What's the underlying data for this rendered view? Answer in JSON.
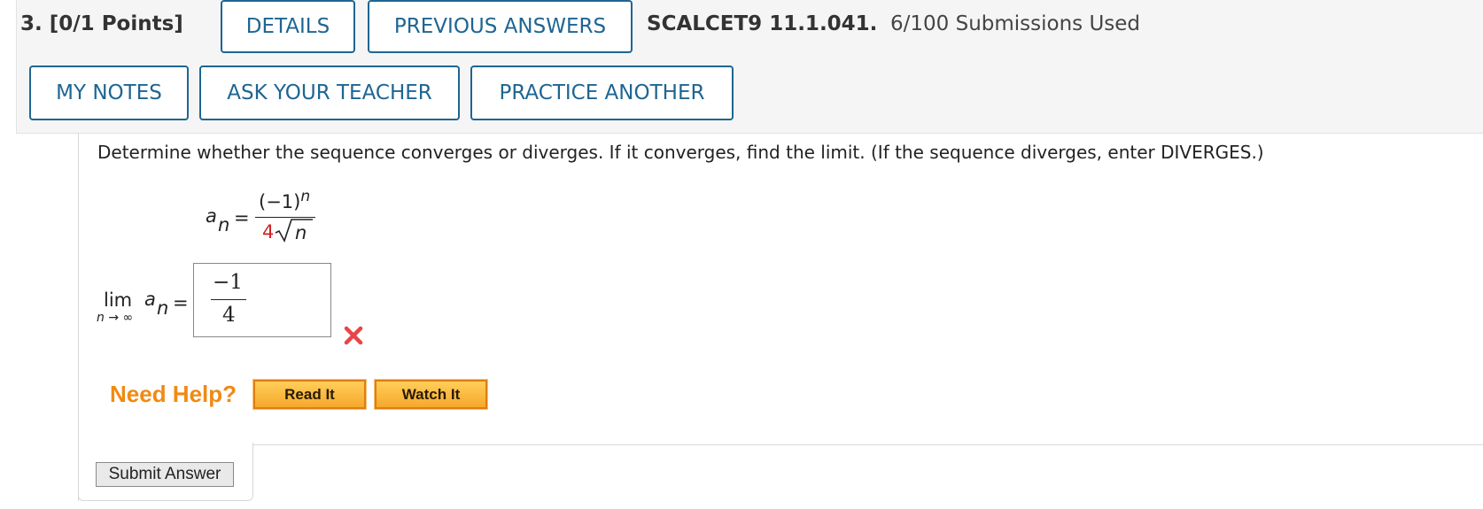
{
  "header": {
    "question_number": "3.",
    "points": "[0/1 Points]",
    "details_label": "DETAILS",
    "previous_answers_label": "PREVIOUS ANSWERS",
    "problem_code": "SCALCET9 11.1.041.",
    "submissions": "6/100 Submissions Used",
    "my_notes_label": "MY NOTES",
    "ask_teacher_label": "ASK YOUR TEACHER",
    "practice_another_label": "PRACTICE ANOTHER"
  },
  "question": {
    "prompt": "Determine whether the sequence converges or diverges. If it converges, find the limit. (If the sequence diverges, enter DIVERGES.)",
    "formula": {
      "lhs_var": "a",
      "lhs_sub": "n",
      "equals": "=",
      "numerator_base": "(−1)",
      "numerator_exp": "n",
      "denominator_coef": "4",
      "denominator_var": "n"
    },
    "limit": {
      "lim": "lim",
      "lim_sub": "n → ∞",
      "var": "a",
      "var_sub": "n",
      "equals": "="
    },
    "answer": {
      "numerator": "−1",
      "denominator": "4",
      "status": "incorrect"
    }
  },
  "help": {
    "label": "Need Help?",
    "read_it": "Read It",
    "watch_it": "Watch It"
  },
  "submit_label": "Submit Answer",
  "colors": {
    "brand_blue": "#1e6592",
    "help_orange": "#f08a12",
    "wrong_red": "#e8454a",
    "coefficient_red": "#d32222"
  },
  "icons": {
    "wrong": "x-mark-icon"
  }
}
